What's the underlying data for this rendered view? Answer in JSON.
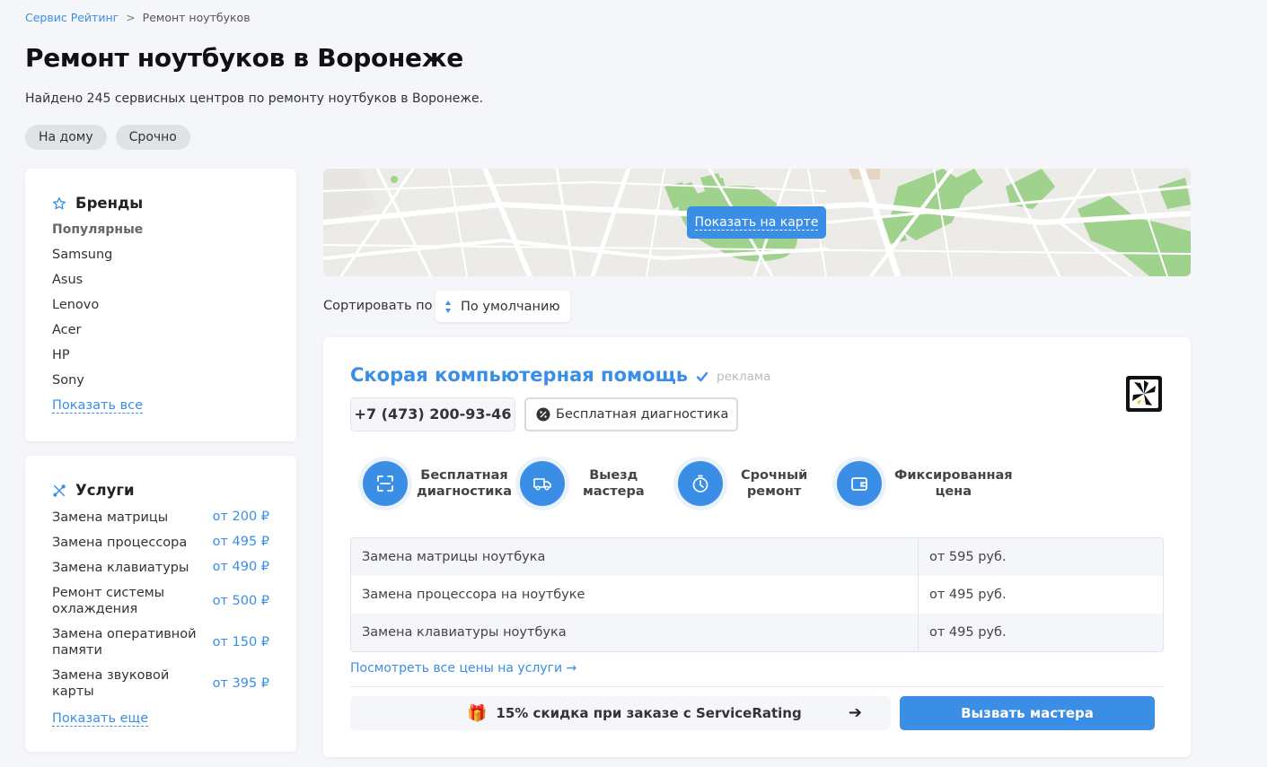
{
  "breadcrumb": {
    "root": "Сервис Рейтинг",
    "separator": ">",
    "current": "Ремонт ноутбуков"
  },
  "page": {
    "title": "Ремонт ноутбуков в Воронеже",
    "subtitle": "Найдено 245 сервисных центров по ремонту ноутбуков в Воронеже."
  },
  "tags": [
    "На дому",
    "Срочно"
  ],
  "brands": {
    "heading": "Бренды",
    "icon": "star-icon",
    "popular_label": "Популярные",
    "items": [
      "Samsung",
      "Asus",
      "Lenovo",
      "Acer",
      "HP",
      "Sony"
    ],
    "show_all": "Показать все"
  },
  "services": {
    "heading": "Услуги",
    "icon": "tools-icon",
    "items": [
      {
        "name": "Замена матрицы",
        "price": "от 200 ₽"
      },
      {
        "name": "Замена процессора",
        "price": "от 495 ₽"
      },
      {
        "name": "Замена клавиатуры",
        "price": "от 490 ₽"
      },
      {
        "name": "Ремонт системы охлаждения",
        "price": "от 500 ₽"
      },
      {
        "name": "Замена оперативной памяти",
        "price": "от 150 ₽"
      },
      {
        "name": "Замена звуковой карты",
        "price": "от 395 ₽"
      }
    ],
    "show_more": "Показать еще"
  },
  "map": {
    "button": "Показать на карте"
  },
  "sort": {
    "label": "Сортировать по",
    "value": "По умолчанию"
  },
  "listing": {
    "name": "Скорая компьютерная помощь",
    "ad_label": "реклама",
    "phone": "+7 (473) 200-93-46",
    "badge": "Бесплатная диагностика",
    "features": [
      {
        "line1": "Бесплатная",
        "line2": "диагностика",
        "icon": "scan-icon"
      },
      {
        "line1": "Выезд",
        "line2": "мастера",
        "icon": "truck-icon"
      },
      {
        "line1": "Срочный",
        "line2": "ремонт",
        "icon": "timer-icon"
      },
      {
        "line1": "Фиксированная",
        "line2": "цена",
        "icon": "wallet-icon"
      }
    ],
    "prices": [
      {
        "service": "Замена матрицы ноутбука",
        "price": "от 595 руб."
      },
      {
        "service": "Замена процессора на ноутбуке",
        "price": "от 495 руб."
      },
      {
        "service": "Замена клавиатуры ноутбука",
        "price": "от 495 руб."
      }
    ],
    "all_prices_link": "Посмотреть все цены на услуги →",
    "promo": "15% скидка при заказе с ServiceRating",
    "call_button": "Вызвать мастера"
  },
  "colors": {
    "accent": "#3a8ee6",
    "background": "#f4f6f9"
  }
}
